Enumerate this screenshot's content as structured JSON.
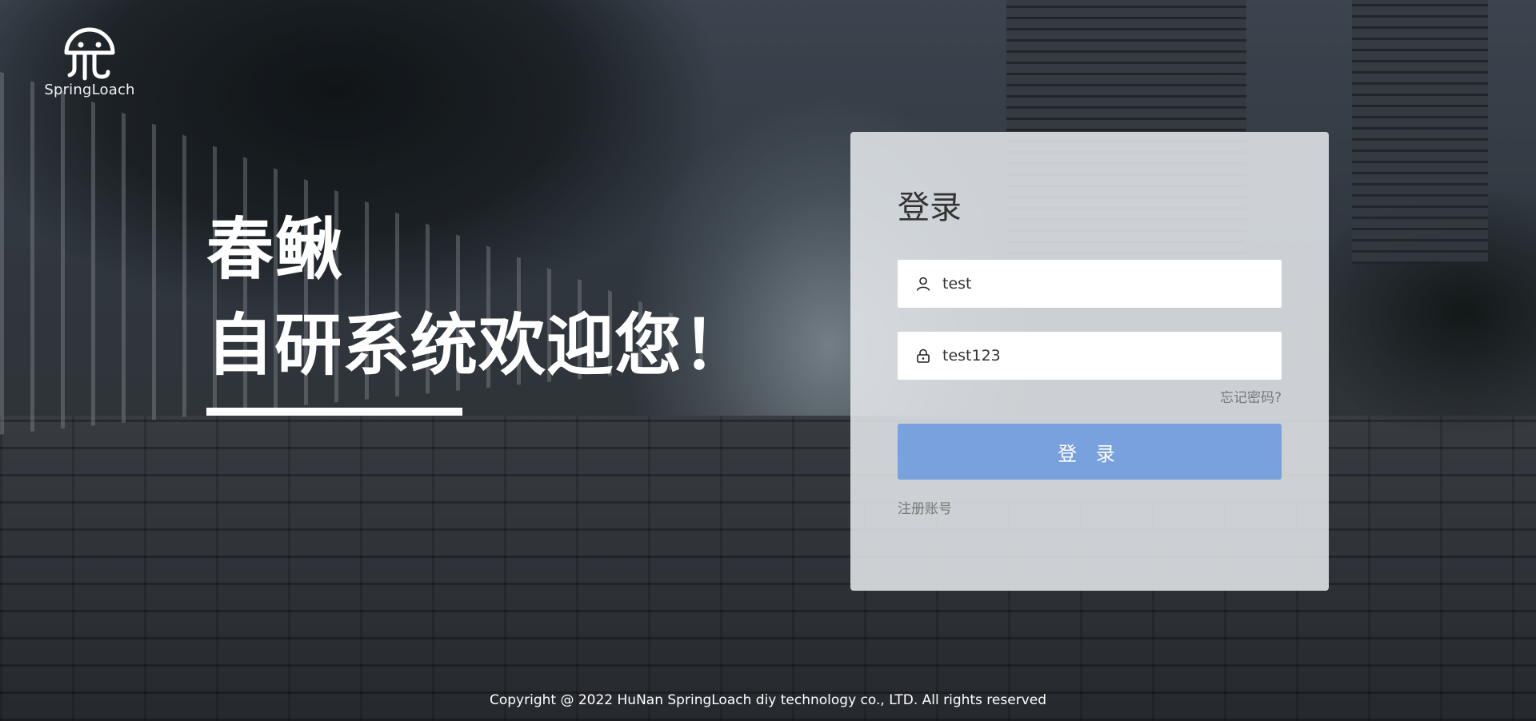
{
  "brand": {
    "name": "SpringLoach",
    "logo_icon": "jellyfish-icon"
  },
  "hero": {
    "line1": "春鳅",
    "line2": "自研系统欢迎您！"
  },
  "login_card": {
    "title": "登录",
    "username": {
      "value": "test",
      "icon": "user-icon"
    },
    "password": {
      "value": "test123",
      "icon": "lock-icon"
    },
    "forgot_link": "忘记密码?",
    "login_button": "登 录",
    "register_link": "注册账号"
  },
  "footer": {
    "copyright": "Copyright @ 2022 HuNan SpringLoach diy technology co., LTD. All rights reserved"
  },
  "colors": {
    "button": "#78a1dd",
    "card_bg": "#e6eaee",
    "text_muted": "#777777"
  }
}
